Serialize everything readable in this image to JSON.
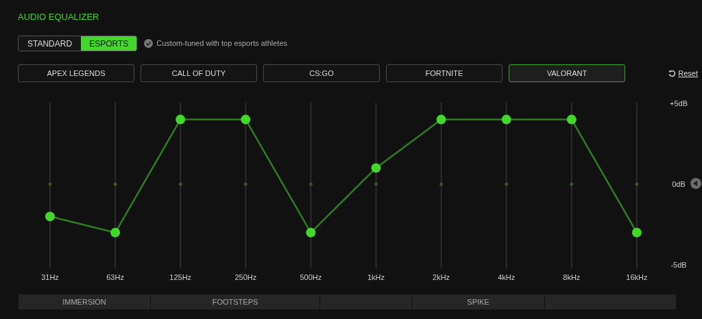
{
  "title": "AUDIO EQUALIZER",
  "modes": [
    {
      "label": "STANDARD",
      "selected": false
    },
    {
      "label": "ESPORTS",
      "selected": true
    }
  ],
  "mode_note": {
    "checked": true,
    "text": "Custom-tuned with top esports athletes"
  },
  "presets": [
    {
      "label": "APEX LEGENDS",
      "selected": false
    },
    {
      "label": "CALL OF DUTY",
      "selected": false
    },
    {
      "label": "CS:GO",
      "selected": false
    },
    {
      "label": "FORTNITE",
      "selected": false
    },
    {
      "label": "VALORANT",
      "selected": true
    }
  ],
  "reset": "Reset",
  "equalizer": {
    "chart_data": {
      "type": "line",
      "categories": [
        "31Hz",
        "63Hz",
        "125Hz",
        "250Hz",
        "500Hz",
        "1kHz",
        "2kHz",
        "4kHz",
        "8kHz",
        "16kHz"
      ],
      "series": [
        {
          "color": "#44d62c",
          "marker": "circle",
          "values": [
            -2,
            -3,
            4,
            4,
            -3,
            1,
            4,
            4,
            4,
            -3
          ]
        }
      ],
      "grid": true,
      "ylim": [
        -5,
        5
      ],
      "yticks": [
        {
          "value": 5,
          "label": "+5dB"
        },
        {
          "value": 0,
          "label": "0dB"
        },
        {
          "value": -5,
          "label": "-5dB"
        }
      ]
    }
  },
  "zones": [
    {
      "kind": "labeled",
      "label": "IMMERSION"
    },
    {
      "kind": "labeled",
      "label": "FOOTSTEPS"
    },
    {
      "kind": "blank"
    },
    {
      "kind": "labeled",
      "label": "SPIKE"
    },
    {
      "kind": "blank"
    }
  ]
}
